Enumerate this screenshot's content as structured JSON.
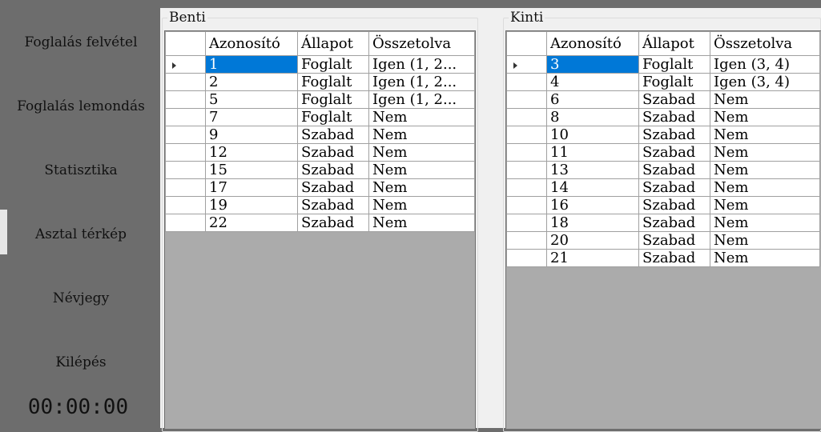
{
  "sidebar": {
    "items": [
      {
        "label": "Foglalás felvétel"
      },
      {
        "label": "Foglalás lemondás"
      },
      {
        "label": "Statisztika"
      },
      {
        "label": "Asztal térkép"
      },
      {
        "label": "Névjegy"
      },
      {
        "label": "Kilépés"
      }
    ],
    "active_index": 3,
    "clock": "00:00:00"
  },
  "benti": {
    "title": "Benti",
    "columns": [
      "Azonosító",
      "Állapot",
      "Összetolva"
    ],
    "rows": [
      [
        "1",
        "Foglalt",
        "Igen (1, 2..."
      ],
      [
        "2",
        "Foglalt",
        "Igen (1, 2..."
      ],
      [
        "5",
        "Foglalt",
        "Igen (1, 2..."
      ],
      [
        "7",
        "Foglalt",
        "Nem"
      ],
      [
        "9",
        "Szabad",
        "Nem"
      ],
      [
        "12",
        "Szabad",
        "Nem"
      ],
      [
        "15",
        "Szabad",
        "Nem"
      ],
      [
        "17",
        "Szabad",
        "Nem"
      ],
      [
        "19",
        "Szabad",
        "Nem"
      ],
      [
        "22",
        "Szabad",
        "Nem"
      ]
    ],
    "selected_row": 0
  },
  "kinti": {
    "title": "Kinti",
    "columns": [
      "Azonosító",
      "Állapot",
      "Összetolva"
    ],
    "rows": [
      [
        "3",
        "Foglalt",
        "Igen (3, 4)"
      ],
      [
        "4",
        "Foglalt",
        "Igen (3, 4)"
      ],
      [
        "6",
        "Szabad",
        "Nem"
      ],
      [
        "8",
        "Szabad",
        "Nem"
      ],
      [
        "10",
        "Szabad",
        "Nem"
      ],
      [
        "11",
        "Szabad",
        "Nem"
      ],
      [
        "13",
        "Szabad",
        "Nem"
      ],
      [
        "14",
        "Szabad",
        "Nem"
      ],
      [
        "16",
        "Szabad",
        "Nem"
      ],
      [
        "18",
        "Szabad",
        "Nem"
      ],
      [
        "20",
        "Szabad",
        "Nem"
      ],
      [
        "21",
        "Szabad",
        "Nem"
      ]
    ],
    "selected_row": 0
  },
  "colors": {
    "selection": "#0078d7",
    "sidebar": "#6d6d6d",
    "grid_background": "#ababab"
  }
}
